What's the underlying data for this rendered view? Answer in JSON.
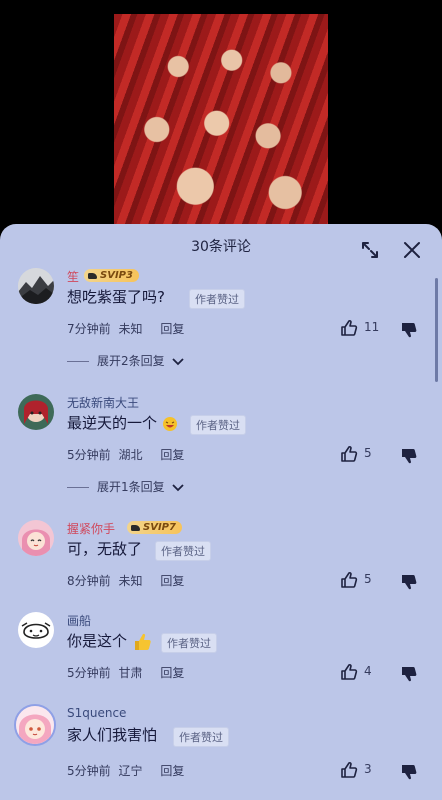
{
  "sheet": {
    "title": "30条评论"
  },
  "comments": [
    {
      "user": "笙",
      "user_color": "red",
      "vip": "SVIP3",
      "text": "想吃紫蛋了吗?",
      "author_liked": "作者赞过",
      "time": "7分钟前",
      "location": "未知",
      "reply": "回复",
      "likes": "11",
      "replies": "展开2条回复",
      "avatar": "ink-landscape"
    },
    {
      "user": "无敌新南大王",
      "user_color": "normal",
      "text": "最逆天的一个",
      "emoji": "laughing-face",
      "author_liked": "作者赞过",
      "time": "5分钟前",
      "location": "湖北",
      "reply": "回复",
      "likes": "5",
      "replies": "展开1条回复",
      "avatar": "anime-red-hair"
    },
    {
      "user": "握紧你手",
      "user_color": "red",
      "vip": "SVIP7",
      "text": "可，无敌了",
      "author_liked": "作者赞过",
      "time": "8分钟前",
      "location": "未知",
      "reply": "回复",
      "likes": "5",
      "avatar": "anime-pink-hair"
    },
    {
      "user": "画船",
      "user_color": "normal",
      "text": "你是这个",
      "emoji": "thumbs-up",
      "author_liked": "作者赞过",
      "time": "5分钟前",
      "location": "甘肃",
      "reply": "回复",
      "likes": "4",
      "avatar": "doodle-face"
    },
    {
      "user": "S1quence",
      "user_color": "normal",
      "text": "家人们我害怕",
      "author_liked": "作者赞过",
      "time": "5分钟前",
      "location": "辽宁",
      "reply": "回复",
      "likes": "3",
      "avatar": "anime-pink-girl"
    }
  ],
  "colors": {
    "sheet_bg": "#bcc6e8",
    "accent_red": "#d0485c"
  }
}
